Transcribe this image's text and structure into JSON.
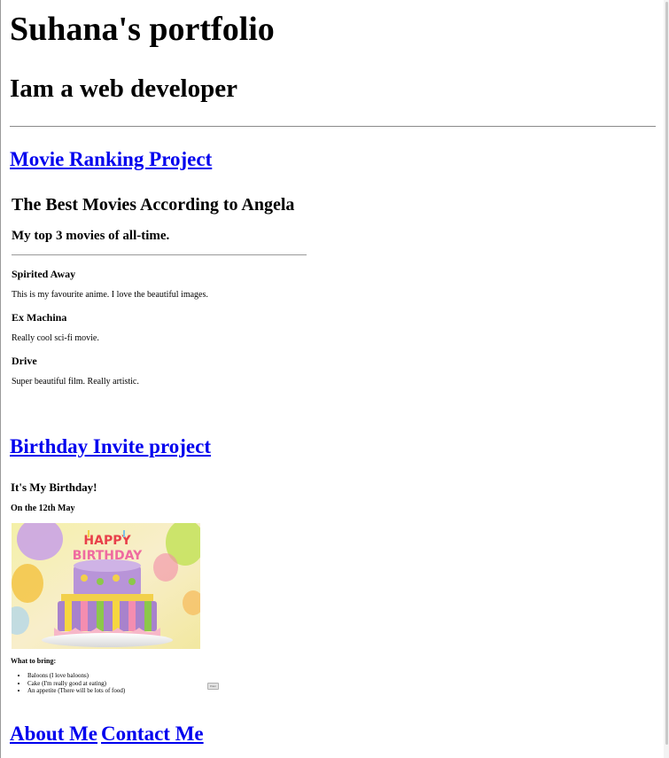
{
  "header": {
    "title": "Suhana's portfolio",
    "subtitle": "Iam a web developer"
  },
  "projects": [
    {
      "link_label": "Movie Ranking Project",
      "preview": {
        "title": "The Best Movies According to Angela",
        "subtitle": "My top 3 movies of all-time.",
        "movies": [
          {
            "name": "Spirited Away",
            "description": "This is my favourite anime. I love the beautiful images."
          },
          {
            "name": "Ex Machina",
            "description": "Really cool sci-fi movie."
          },
          {
            "name": "Drive",
            "description": "Super beautiful film. Really artistic."
          }
        ]
      }
    },
    {
      "link_label": "Birthday Invite project",
      "preview": {
        "title": "It's My Birthday!",
        "date": "On the 12th May",
        "image_alt": "HAPPY BIRTHDAY",
        "bring_heading": "What to bring:",
        "bring_items": [
          "Baloons (I love baloons)",
          "Cake (I'm really good at eating)",
          "An appetite (There will be lots of food)"
        ],
        "mini_button": "Enter"
      }
    }
  ],
  "footer": {
    "about_label": "About Me",
    "contact_label": "Contact Me"
  },
  "colors": {
    "link": "#0000ee",
    "text": "#000000",
    "divider": "#8a8a8a"
  }
}
